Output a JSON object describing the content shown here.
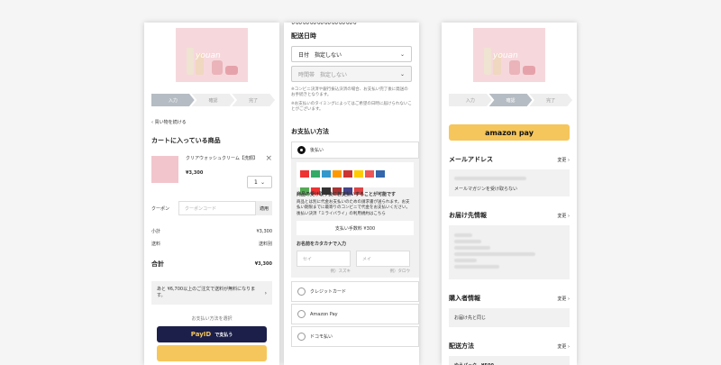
{
  "brand": "youan",
  "steps": [
    "入力",
    "確認",
    "完了"
  ],
  "cart": {
    "back_link": "買い物を続ける",
    "title": "カートに入っている商品",
    "item_name": "クリアウォッシュクリーム【洗顔】",
    "item_price": "¥3,300",
    "item_qty": "1",
    "coupon_label": "クーポン",
    "coupon_placeholder": "クーポンコード",
    "coupon_apply": "適用",
    "subtotal_label": "小計",
    "subtotal_value": "¥3,300",
    "shipping_label": "送料",
    "shipping_value": "送料別",
    "total_label": "合計",
    "total_value": "¥3,300",
    "free_ship_notice": "あと ¥6,700以上のご注文で送料が無料になります。",
    "payment_choose": "お支払い方法を選択",
    "payid_label": "で支払う",
    "payid_brand": "PayID"
  },
  "delivery": {
    "section_title": "配送日時",
    "date_select": "日付　指定しない",
    "time_select": "時間帯　指定しない",
    "note1": "※コンビニ決済や銀行振込決済の場合、お支払い完了後に発送のお手続きとなります。",
    "note2": "※お支払いのタイミングによってはご希望の日時に届けられないことがございます。"
  },
  "payment": {
    "section_title": "お支払い方法",
    "opt_postpay": "後払い",
    "postpay_heading": "商品の受け取り後にお支払いすることが可能です",
    "postpay_desc": "商品とは別に代金お支払いのための請求書が送られます。お支払い期限までに最寄りのコンビニで代金をお支払いください。後払い決済「ミライバライ」の利用規約はこちら",
    "postpay_fee": "支払い手数料 ¥300",
    "kana_heading": "お名前をカタカナで入力",
    "kana_sei": "セイ",
    "kana_mei": "メイ",
    "kana_sei_ex": "例）スズキ",
    "kana_mei_ex": "例）タロウ",
    "opt_credit": "クレジットカード",
    "opt_amazon": "Amazon Pay",
    "opt_docomo": "ドコモ払い"
  },
  "amazon": {
    "pay_button": "amazon pay",
    "email_title": "メールアドレス",
    "change": "変更",
    "email_optin": "メールマガジンを受け取らない",
    "ship_title": "お届け先情報",
    "buyer_title": "購入者情報",
    "buyer_value": "お届け先と同じ",
    "method_title": "配送方法",
    "method_value": "ゆうパック　¥500"
  },
  "colors": {
    "amazon_yellow": "#f5c65c",
    "payid_navy": "#1c1f4a",
    "step_active": "#b5bcc3"
  }
}
